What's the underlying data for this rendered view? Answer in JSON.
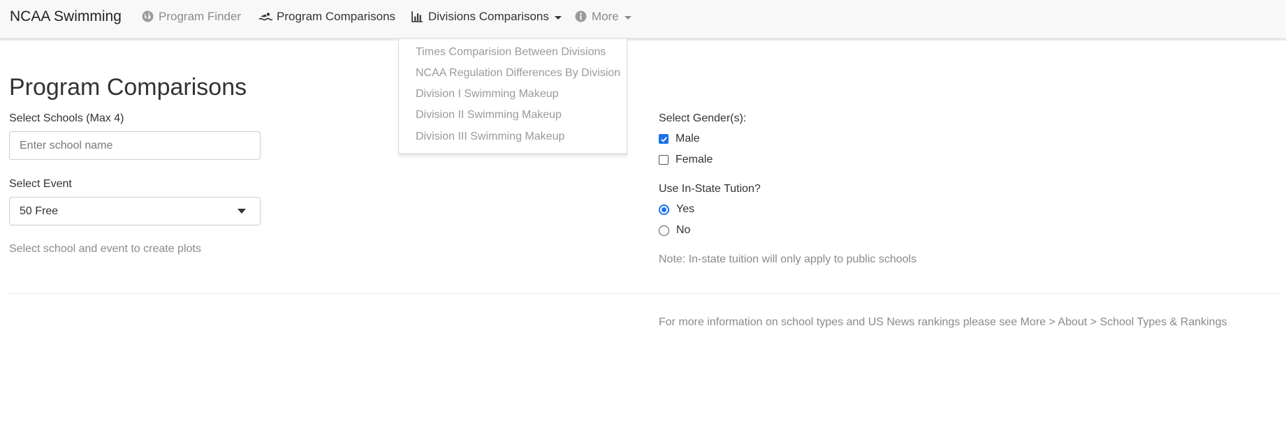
{
  "navbar": {
    "brand": "NCAA Swimming",
    "items": [
      {
        "label": "Program Finder",
        "icon": "globe-icon"
      },
      {
        "label": "Program Comparisons",
        "icon": "swimmer-icon"
      },
      {
        "label": "Divisions Comparisons",
        "icon": "bar-chart-icon"
      },
      {
        "label": "More",
        "icon": "info-icon"
      }
    ]
  },
  "dropdown": {
    "items": [
      "Times Comparision Between Divisions",
      "NCAA Regulation Differences By Division",
      "Division I Swimming Makeup",
      "Division II Swimming Makeup",
      "Division III Swimming Makeup"
    ]
  },
  "main": {
    "title": "Program Comparisons",
    "schools_label": "Select Schools (Max 4)",
    "schools_placeholder": "Enter school name",
    "event_label": "Select Event",
    "event_value": "50 Free",
    "help_text": "Select school and event to create plots",
    "gender_label": "Select Gender(s):",
    "gender_options": [
      {
        "label": "Male",
        "checked": true
      },
      {
        "label": "Female",
        "checked": false
      }
    ],
    "tuition_label": "Use In-State Tution?",
    "tuition_options": [
      {
        "label": "Yes",
        "checked": true
      },
      {
        "label": "No",
        "checked": false
      }
    ],
    "tuition_note": "Note: In-state tuition will only apply to public schools",
    "footer_note": "For more information on school types and US News rankings please see More > About > School Types & Rankings"
  },
  "colors": {
    "accent": "#1a73e8",
    "navbar_bg": "#f8f8f8",
    "muted_text": "#8a8a8a"
  }
}
